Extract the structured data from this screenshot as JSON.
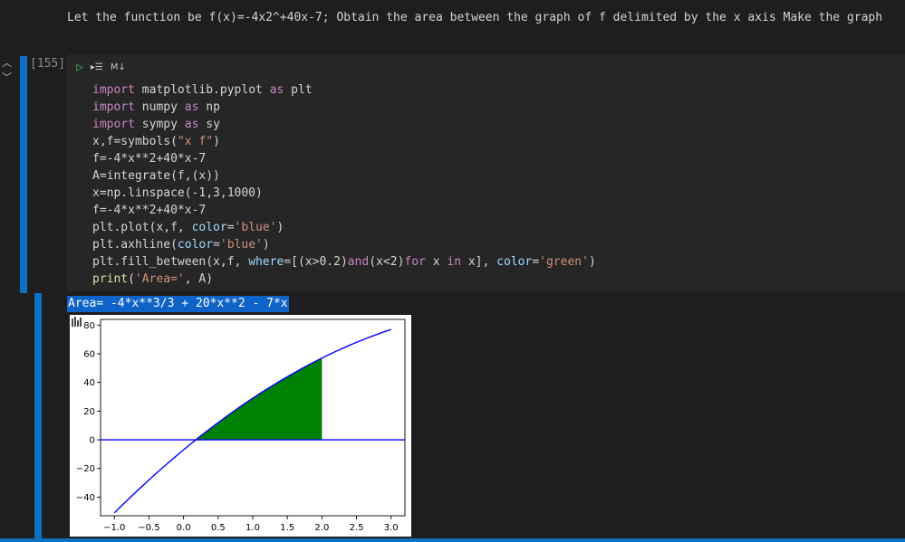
{
  "markdown": {
    "text": "Let the function be f(x)=-4x2^+40x-7; Obtain the area between the graph of f delimited by the x axis Make the graph"
  },
  "cell": {
    "exec_count": "[155]",
    "toolbar": {
      "cell_type": "M↓"
    },
    "code_lines": [
      [
        {
          "t": "import",
          "c": "kw"
        },
        {
          "t": " matplotlib.pyplot "
        },
        {
          "t": "as",
          "c": "kw"
        },
        {
          "t": " plt"
        }
      ],
      [
        {
          "t": "import",
          "c": "kw"
        },
        {
          "t": " numpy "
        },
        {
          "t": "as",
          "c": "kw"
        },
        {
          "t": " np"
        }
      ],
      [
        {
          "t": "import",
          "c": "kw"
        },
        {
          "t": " sympy "
        },
        {
          "t": "as",
          "c": "kw"
        },
        {
          "t": " sy"
        }
      ],
      [
        {
          "t": "x,f=symbols("
        },
        {
          "t": "\"x f\"",
          "c": "str"
        },
        {
          "t": ")"
        }
      ],
      [
        {
          "t": "f=-4*x**2+40*x-7"
        }
      ],
      [
        {
          "t": "A=integrate(f,(x))"
        }
      ],
      [
        {
          "t": "x=np.linspace(-1,3,1000)"
        }
      ],
      [
        {
          "t": "f=-4*x**2+40*x-7"
        }
      ],
      [
        {
          "t": "plt.plot(x,f, "
        },
        {
          "t": "color",
          "c": "param"
        },
        {
          "t": "="
        },
        {
          "t": "'blue'",
          "c": "str"
        },
        {
          "t": ")"
        }
      ],
      [
        {
          "t": "plt.axhline("
        },
        {
          "t": "color",
          "c": "param"
        },
        {
          "t": "="
        },
        {
          "t": "'blue'",
          "c": "str"
        },
        {
          "t": ")"
        }
      ],
      [
        {
          "t": "plt.fill_between(x,f, "
        },
        {
          "t": "where",
          "c": "param"
        },
        {
          "t": "=[(x>0.2)"
        },
        {
          "t": "and",
          "c": "kw"
        },
        {
          "t": "(x<2)"
        },
        {
          "t": "for",
          "c": "kw"
        },
        {
          "t": " x "
        },
        {
          "t": "in",
          "c": "kw"
        },
        {
          "t": " x], "
        },
        {
          "t": "color",
          "c": "param"
        },
        {
          "t": "="
        },
        {
          "t": "'green'",
          "c": "str"
        },
        {
          "t": ")"
        }
      ],
      [
        {
          "t": "print",
          "c": "fn"
        },
        {
          "t": "("
        },
        {
          "t": "'Area='",
          "c": "str"
        },
        {
          "t": ", A)"
        }
      ]
    ]
  },
  "output": {
    "text": "Area= -4*x**3/3 + 20*x**2 - 7*x"
  },
  "chart_data": {
    "type": "line",
    "x_range": [
      -1,
      3
    ],
    "function": "-4*x**2+40*x-7",
    "line_color": "#0000ff",
    "axhline_y": 0,
    "fill": {
      "x_from": 0.2,
      "x_to": 2.0,
      "color": "#008000"
    },
    "xlim": [
      -1.2,
      3.2
    ],
    "ylim": [
      -53,
      84
    ],
    "xticks": [
      -1.0,
      -0.5,
      0.0,
      0.5,
      1.0,
      1.5,
      2.0,
      2.5,
      3.0
    ],
    "xtick_labels": [
      "−1.0",
      "−0.5",
      "0.0",
      "0.5",
      "1.0",
      "1.5",
      "2.0",
      "2.5",
      "3.0"
    ],
    "yticks": [
      -40,
      -20,
      0,
      20,
      40,
      60,
      80
    ],
    "ytick_labels": [
      "−40",
      "−20",
      "0",
      "20",
      "40",
      "60",
      "80"
    ]
  },
  "colors": {
    "accent": "#0e70c0",
    "selection": "#0e63c9"
  }
}
